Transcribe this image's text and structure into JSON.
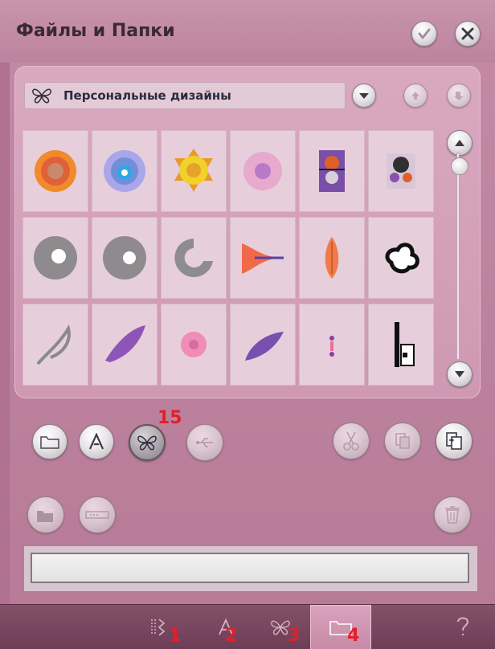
{
  "header": {
    "title": "Файлы и Папки",
    "ok_icon": "checkmark-icon",
    "close_icon": "close-icon"
  },
  "folder": {
    "name": "Персональные дизайны",
    "icon": "butterfly-icon"
  },
  "designs": [
    {
      "name": "orange-flower-design"
    },
    {
      "name": "blue-mandala-design"
    },
    {
      "name": "yellow-star-flower-design"
    },
    {
      "name": "pink-flower-design"
    },
    {
      "name": "colorful-ornament-design"
    },
    {
      "name": "purple-ornament-design"
    },
    {
      "name": "grey-circle-monogram-design"
    },
    {
      "name": "grey-circle-monogram-2-design"
    },
    {
      "name": "grey-arc-design"
    },
    {
      "name": "orange-wing-arrow-design"
    },
    {
      "name": "orange-wing-design"
    },
    {
      "name": "black-cloud-design"
    },
    {
      "name": "grey-leaf-swirl-design"
    },
    {
      "name": "purple-lace-leaf-design"
    },
    {
      "name": "pink-small-flower-design"
    },
    {
      "name": "purple-leaf-design"
    },
    {
      "name": "small-figure-design"
    },
    {
      "name": "black-white-building-design"
    }
  ],
  "annotations": {
    "active_tab": "15",
    "tab1": "1",
    "tab2": "2",
    "tab3": "3",
    "tab4": "4"
  },
  "colors": {
    "background": "#c48aa6",
    "panel": "#d9a9c0",
    "taskbar": "#7a4660",
    "annotation": "#e0202a"
  },
  "filename_field": {
    "value": ""
  }
}
